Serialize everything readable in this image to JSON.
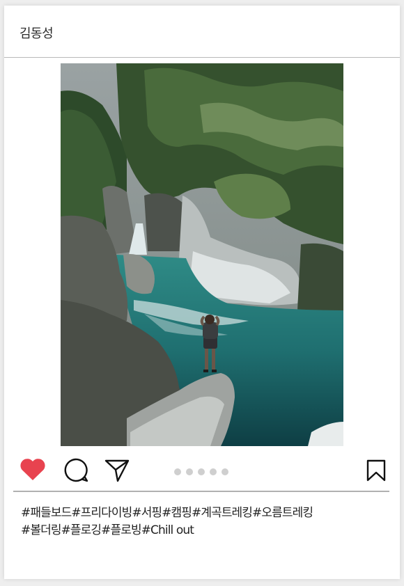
{
  "post": {
    "username": "김동성",
    "image_alt": "Hiker standing on a rock by a turquoise river pool below a waterfall in a green forest gorge"
  },
  "actions": {
    "like_icon": "heart-icon",
    "comment_icon": "comment-icon",
    "share_icon": "paper-plane-icon",
    "save_icon": "bookmark-icon",
    "liked": true,
    "carousel_count": 5
  },
  "caption": {
    "line1": "#패들보드#프리다이빙#서핑#캠핑#계곡트레킹#오름트레킹",
    "line2": "#볼더링#플로깅#플로빙#Chill out"
  },
  "colors": {
    "heart": "#e8434f",
    "dot": "#cfcfcf",
    "divider": "#b0b0b0"
  }
}
